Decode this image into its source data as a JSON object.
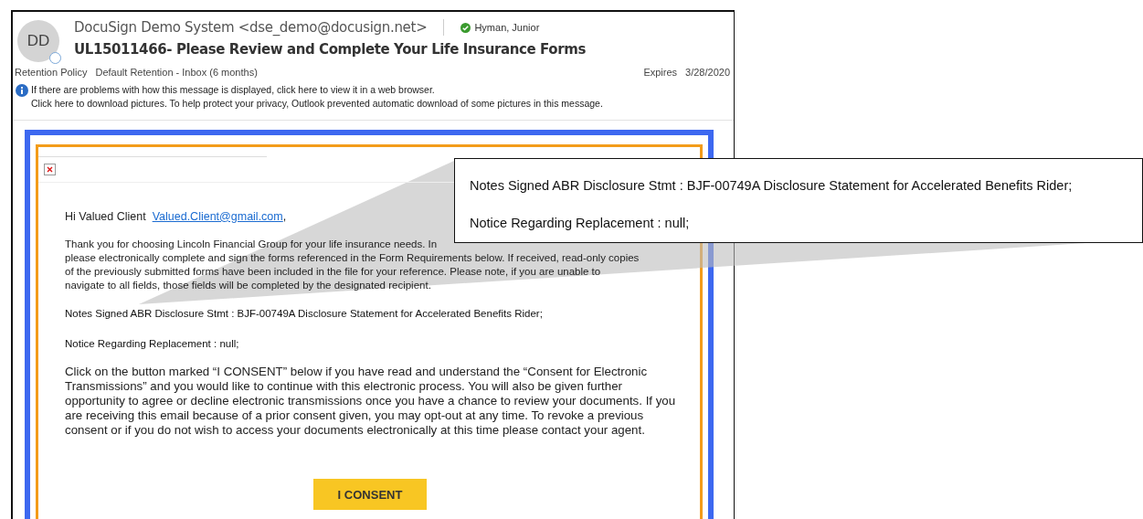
{
  "email": {
    "avatar_initials": "DD",
    "sender": "DocuSign Demo System <dse_demo@docusign.net>",
    "recipient": "Hyman, Junior",
    "subject": "UL15011466- Please Review and Complete Your Life Insurance Forms",
    "retention_label": "Retention Policy",
    "retention_value": "Default Retention - Inbox (6 months)",
    "expires_label": "Expires",
    "expires_date": "3/28/2020",
    "info_lines": [
      "If there are problems with how this message is displayed, click here to view it in a web browser.",
      "Click here to download pictures. To help protect your privacy, Outlook prevented automatic download of some pictures in this message."
    ]
  },
  "message": {
    "greeting": "Hi Valued Client",
    "greeting_link": "Valued.Client@gmail.com",
    "greeting_end": ",",
    "intro_lines": [
      "Thank you for choosing Lincoln Financial Group for your life insurance needs. In",
      "please electronically complete and sign the forms referenced in the Form Requirements below. If received, read-only copies",
      "of the previously submitted forms have been included in the file for your reference. Please note, if you are unable to",
      "navigate to all fields, those fields will be completed by the designated recipient."
    ],
    "notes": [
      "Notes Signed ABR Disclosure Stmt : BJF-00749A Disclosure Statement for Accelerated Benefits Rider;",
      "Notice Regarding Replacement : null;"
    ],
    "consent_text": "Click on the button marked “I CONSENT” below if you have read and understand the “Consent for Electronic Transmissions” and you would like to continue with this electronic process. You will also be given further opportunity to agree or decline electronic transmissions once you have a chance to review your documents. If you are receiving this email because of a prior consent given, you may opt-out at any time. To revoke a previous consent or if you do not wish to access your documents electronically at this time please contact your agent.",
    "consent_button": "I CONSENT"
  },
  "callout": {
    "lines": [
      "Notes Signed ABR Disclosure Stmt : BJF-00749A Disclosure Statement for Accelerated Benefits Rider;",
      "Notice Regarding Replacement : null;"
    ]
  }
}
